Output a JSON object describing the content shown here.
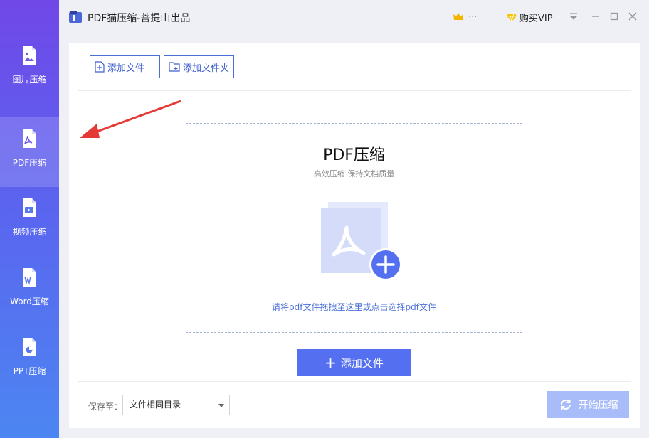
{
  "app": {
    "title": "PDF猫压缩-菩提山出品"
  },
  "user": {
    "name_visible": "...",
    "vip_label": "购买VIP"
  },
  "sidebar": {
    "items": [
      {
        "label": "图片压缩",
        "icon": "image-file-icon",
        "active": false
      },
      {
        "label": "PDF压缩",
        "icon": "pdf-file-icon",
        "active": true
      },
      {
        "label": "视频压缩",
        "icon": "video-file-icon",
        "active": false
      },
      {
        "label": "Word压缩",
        "icon": "word-file-icon",
        "active": false
      },
      {
        "label": "PPT压缩",
        "icon": "ppt-file-icon",
        "active": false
      }
    ]
  },
  "toolbar": {
    "add_file": "添加文件",
    "add_folder": "添加文件夹"
  },
  "dropzone": {
    "title": "PDF压缩",
    "subtitle": "高效压缩 保持文档质量",
    "hint": "请将pdf文件拖拽至这里或点击选择pdf文件"
  },
  "main_button": {
    "label": "添加文件"
  },
  "footer": {
    "save_label": "保存至：",
    "save_value": "文件相同目录",
    "start_label": "开始压缩"
  },
  "colors": {
    "accent": "#5470f0",
    "sidebar_top": "#7048e8",
    "sidebar_bottom": "#4c86f2",
    "start_disabled": "#a9bcfa",
    "annotation_arrow": "#e53935"
  }
}
